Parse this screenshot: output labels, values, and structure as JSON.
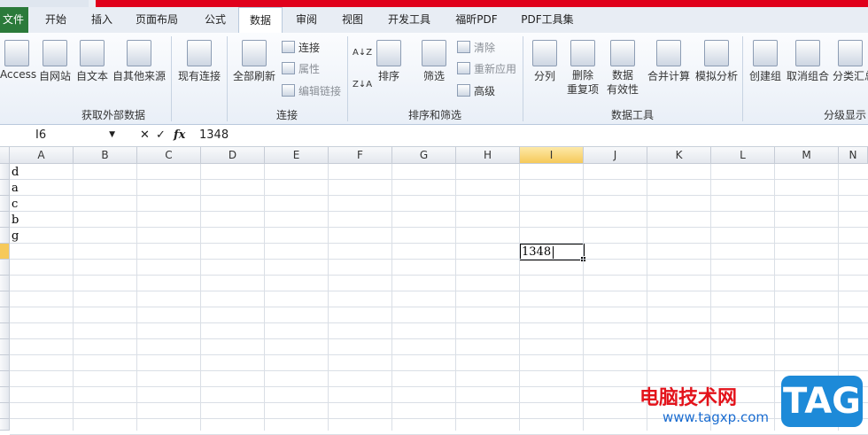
{
  "tabs": {
    "file": "文件",
    "items": [
      "开始",
      "插入",
      "页面布局",
      "公式",
      "数据",
      "审阅",
      "视图",
      "开发工具",
      "福昕PDF",
      "PDF工具集"
    ],
    "active": "数据"
  },
  "ribbon": {
    "external": {
      "label": "获取外部数据",
      "access": "Access",
      "web": "自网站",
      "text": "自文本",
      "other": "自其他来源",
      "existing": "现有连接"
    },
    "connections": {
      "label": "连接",
      "refresh_all": "全部刷新",
      "connect": "连接",
      "properties": "属性",
      "edit_links": "编辑链接"
    },
    "sort_filter": {
      "label": "排序和筛选",
      "sort": "排序",
      "filter": "筛选",
      "clear": "清除",
      "reapply": "重新应用",
      "advanced": "高级",
      "sort_az": "A↓Z",
      "sort_za": "Z↓A"
    },
    "data_tools": {
      "label": "数据工具",
      "text_to_cols": "分列",
      "remove_dup_1": "删除",
      "remove_dup_2": "重复项",
      "validation_1": "数据",
      "validation_2": "有效性",
      "consolidate": "合并计算",
      "whatif": "模拟分析"
    },
    "outline": {
      "label": "分级显示",
      "group": "创建组",
      "ungroup": "取消组合",
      "subtotal": "分类汇总"
    }
  },
  "formula_bar": {
    "name_box": "I6",
    "cancel": "✕",
    "enter": "✓",
    "fx": "fx",
    "value": "1348"
  },
  "columns": [
    "A",
    "B",
    "C",
    "D",
    "E",
    "F",
    "G",
    "H",
    "I",
    "J",
    "K",
    "L",
    "M",
    "N"
  ],
  "selected_column": "I",
  "cells": {
    "A1": "d",
    "A2": "a",
    "A3": "c",
    "A4": "b",
    "A5": "g",
    "I6": "1348"
  },
  "watermark": {
    "text": "电脑技术网",
    "url": "www.tagxp.com",
    "logo": "TAG"
  }
}
